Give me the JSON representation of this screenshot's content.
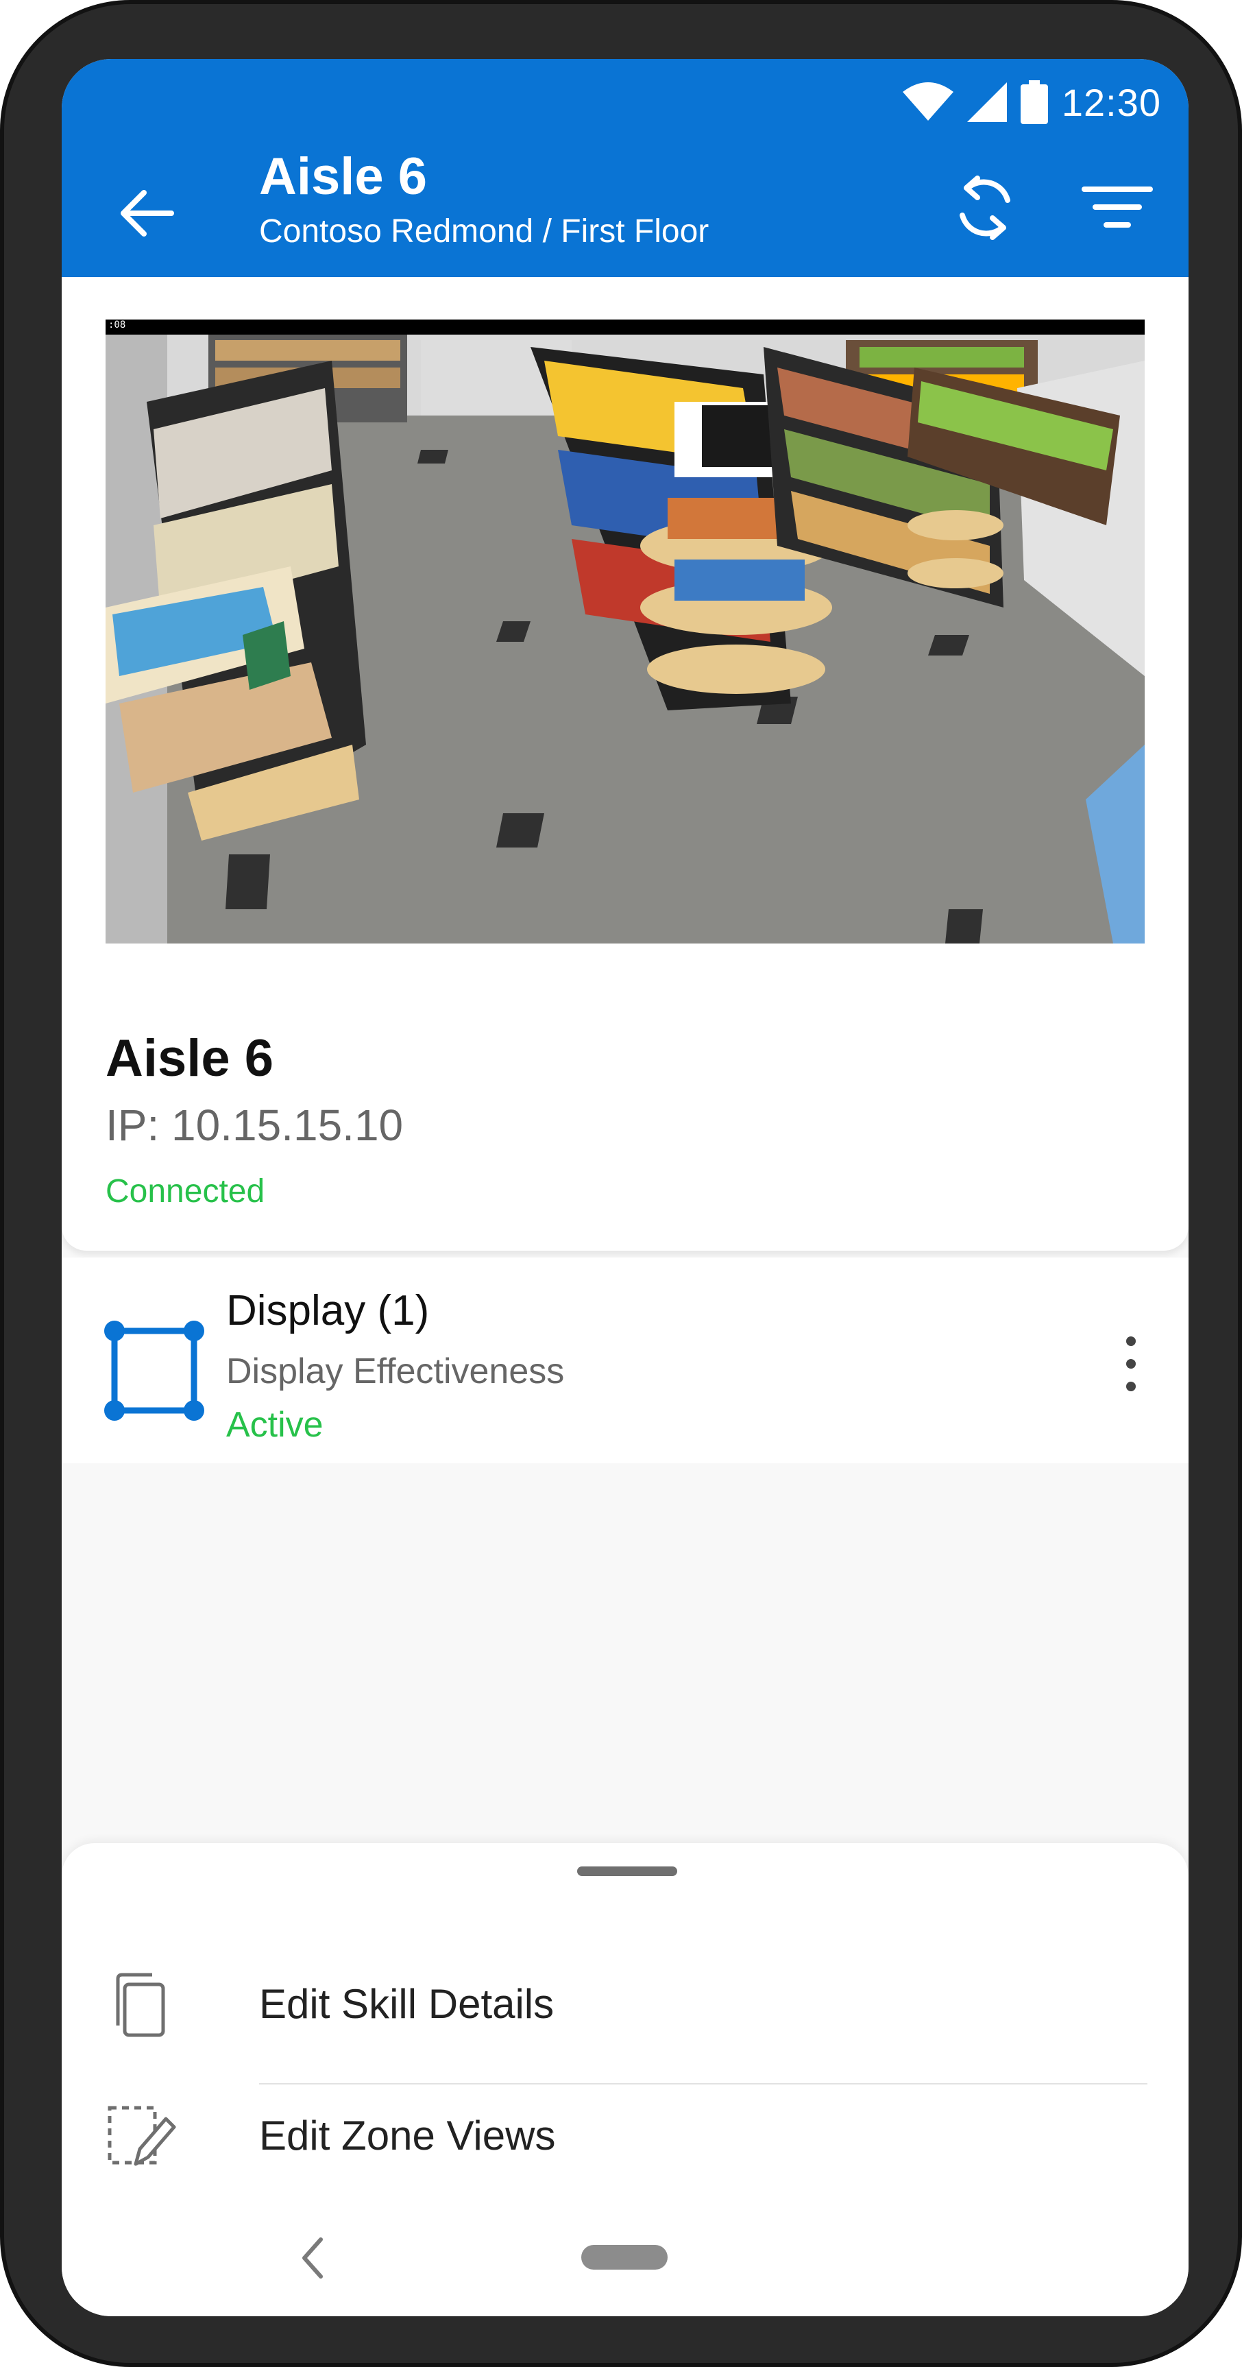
{
  "status_bar": {
    "time": "12:30"
  },
  "header": {
    "title": "Aisle 6",
    "subtitle": "Contoso Redmond / First Floor",
    "icons": [
      "arrow-back-icon",
      "refresh-icon",
      "filter-icon"
    ]
  },
  "camera": {
    "feed_stamp": ":08",
    "name": "Aisle 6",
    "ip": "IP: 10.15.15.10",
    "status": "Connected"
  },
  "skill": {
    "name": "Display (1)",
    "description": "Display Effectiveness",
    "status": "Active",
    "icon": "zone-select-icon"
  },
  "sheet": {
    "items": [
      {
        "label": "Edit Skill Details",
        "icon": "copy-icon"
      },
      {
        "label": "Edit Zone Views",
        "icon": "zone-edit-icon"
      }
    ]
  },
  "colors": {
    "brand": "#0A74D4",
    "success": "#27C14A",
    "text_secondary": "#666666"
  }
}
